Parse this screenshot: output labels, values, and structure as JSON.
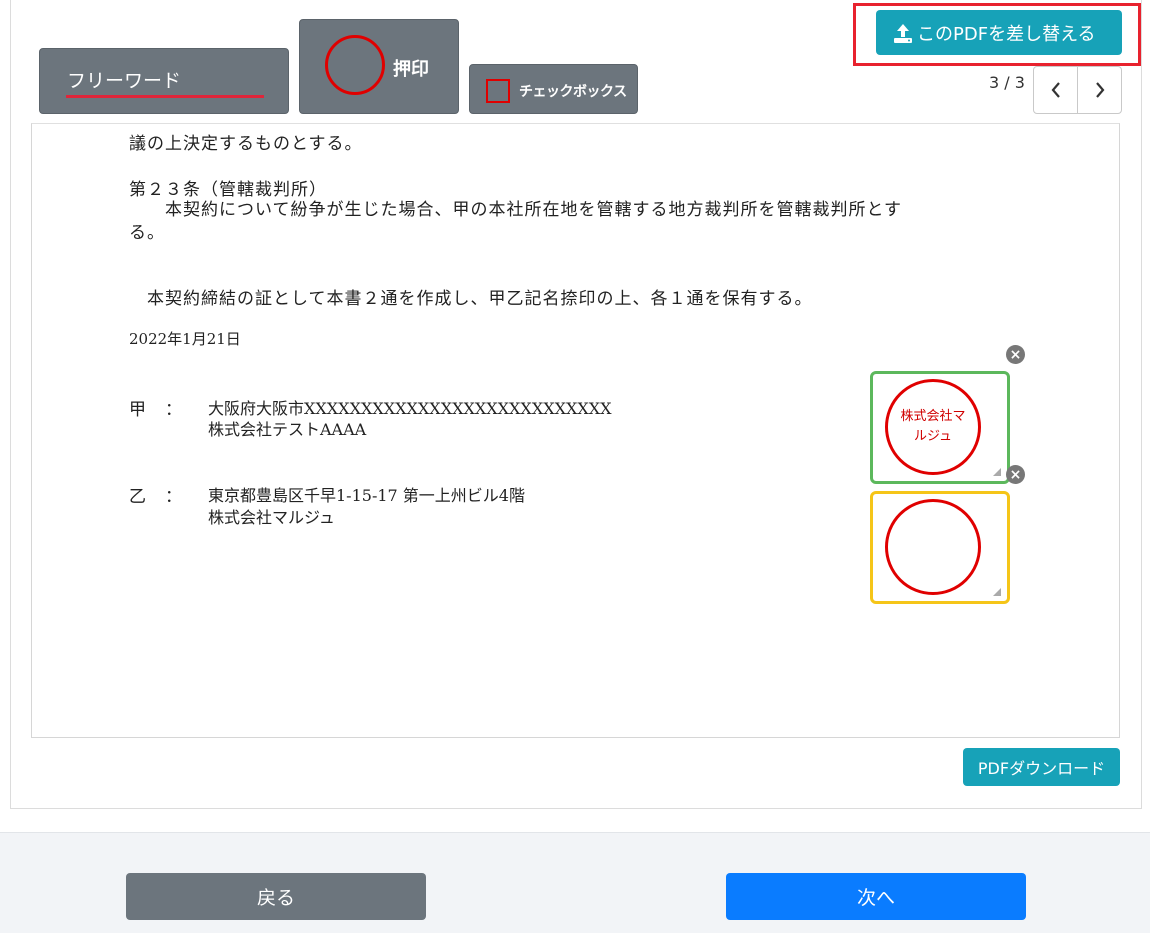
{
  "toolbar": {
    "freeword_label": "フリーワード",
    "stamp_label": "押印",
    "checkbox_label": "チェックボックス"
  },
  "replace_button_label": "このPDFを差し替える",
  "pager": {
    "current": "3 / 3",
    "prev_icon": "chevron-left",
    "next_icon": "chevron-right"
  },
  "document": {
    "line1": "議の上決定するものとする。",
    "line2": "第２３条（管轄裁判所）",
    "line3": "　　本契約について紛争が生じた場合、甲の本社所在地を管轄する地方裁判所を管轄裁判所とす",
    "line4": "る。",
    "line5": "　本契約締結の証として本書２通を作成し、甲乙記名捺印の上、各１通を保有する。",
    "date": "2022年1月21日",
    "party_a_label": "甲　：",
    "party_a_address": "大阪府大阪市XXXXXXXXXXXXXXXXXXXXXXXXXXX",
    "party_a_name": "株式会社テストAAAA",
    "party_b_label": "乙　：",
    "party_b_address": "東京都豊島区千早1-15-17 第一上州ビル4階",
    "party_b_name": "株式会社マルジュ"
  },
  "stamps": {
    "stamp1_text": "株式会社マルジュ",
    "stamp1_line1": "株式会社マ",
    "stamp1_line2": "ルジュ",
    "close_glyph": "×"
  },
  "download_button_label": "PDFダウンロード",
  "footer": {
    "back_label": "戻る",
    "next_label": "次へ"
  },
  "colors": {
    "teal": "#17a2b8",
    "gray": "#6c757d",
    "blue": "#0a7cff",
    "red": "#e00000",
    "green": "#5cb85c",
    "yellow": "#f5c518"
  }
}
